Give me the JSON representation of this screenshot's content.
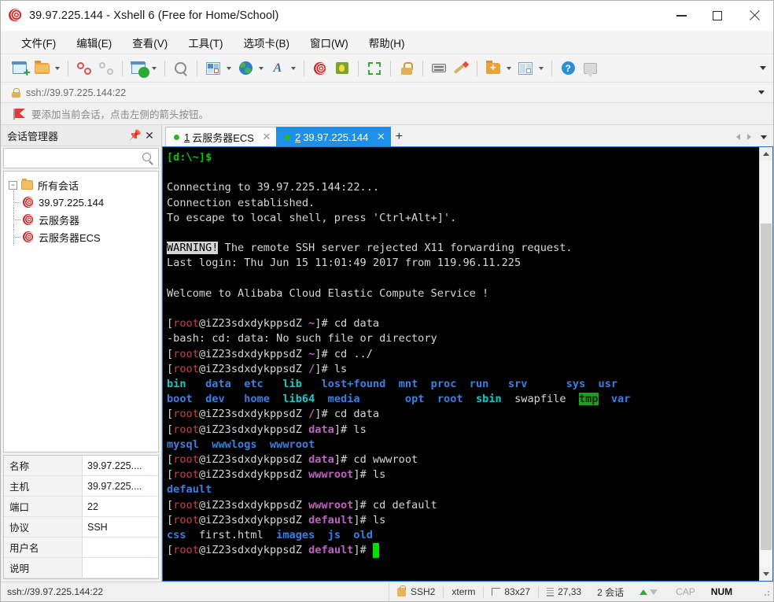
{
  "window": {
    "title": "39.97.225.144 - Xshell 6 (Free for Home/School)",
    "app_icon": "snail-icon",
    "minimize_label": "─",
    "maximize_label": "□",
    "close_label": "✕"
  },
  "menubar": {
    "items": [
      {
        "label": "文件(F)",
        "name": "menu-file"
      },
      {
        "label": "编辑(E)",
        "name": "menu-edit"
      },
      {
        "label": "查看(V)",
        "name": "menu-view"
      },
      {
        "label": "工具(T)",
        "name": "menu-tools"
      },
      {
        "label": "选项卡(B)",
        "name": "menu-tabs"
      },
      {
        "label": "窗口(W)",
        "name": "menu-window"
      },
      {
        "label": "帮助(H)",
        "name": "menu-help"
      }
    ]
  },
  "toolbar": {
    "icons": [
      "new-session-icon",
      "open-folder-icon",
      "disconnect-icon",
      "link-icon",
      "session-properties-icon",
      "find-icon",
      "layout-icon",
      "globe-icon",
      "font-icon",
      "snail-icon",
      "quick-command-icon",
      "fullscreen-icon",
      "lock-icon",
      "keyboard-icon",
      "highlight-icon",
      "transfer-icon",
      "split-view-icon",
      "help-icon",
      "chat-icon"
    ],
    "overflow_label": "▼"
  },
  "address": {
    "icon": "lock-icon",
    "value": "ssh://39.97.225.144:22",
    "dropdown_label": "▼"
  },
  "notice": {
    "icon": "red-flag-icon",
    "text": "要添加当前会话，点击左侧的箭头按钮。"
  },
  "session_manager": {
    "title": "会话管理器",
    "pin_label": "中",
    "close_label": "✕",
    "search_value": "",
    "search_placeholder": "",
    "tree": {
      "root_label": "所有会话",
      "toggle_label": "−",
      "children": [
        {
          "label": "39.97.225.144",
          "icon": "snail-icon"
        },
        {
          "label": "云服务器",
          "icon": "snail-icon"
        },
        {
          "label": "云服务器ECS",
          "icon": "snail-icon"
        }
      ]
    },
    "properties": [
      {
        "key": "名称",
        "value": "39.97.225...."
      },
      {
        "key": "主机",
        "value": "39.97.225...."
      },
      {
        "key": "端口",
        "value": "22"
      },
      {
        "key": "协议",
        "value": "SSH"
      },
      {
        "key": "用户名",
        "value": ""
      },
      {
        "key": "说明",
        "value": ""
      }
    ]
  },
  "tabs": {
    "items": [
      {
        "number": "1",
        "label": "云服务器ECS",
        "active": false,
        "status": "connected",
        "close_label": "✕"
      },
      {
        "number": "2",
        "label": "39.97.225.144",
        "active": true,
        "status": "connected",
        "close_label": "✕"
      }
    ],
    "add_label": "+",
    "nav_left": "◀",
    "nav_right": "▶",
    "nav_menu": "▼"
  },
  "terminal": {
    "colors": {
      "background": "#000000",
      "foreground": "#cfcfcf",
      "green": "#00cc00",
      "blue": "#3b7fe0",
      "cyan": "#19c8c8",
      "magenta": "#c060c0",
      "cursor": "#00e000",
      "tmp_highlight_bg": "#1ea01e"
    },
    "lines": [
      [
        {
          "t": "[d:\\~]$",
          "c": "c-green"
        }
      ],
      [],
      [
        {
          "t": "Connecting to 39.97.225.144:22...",
          "c": "c-white"
        }
      ],
      [
        {
          "t": "Connection established.",
          "c": "c-white"
        }
      ],
      [
        {
          "t": "To escape to local shell, press 'Ctrl+Alt+]'.",
          "c": "c-white"
        }
      ],
      [],
      [
        {
          "t": "WARNING!",
          "c": "inv"
        },
        {
          "t": " The remote SSH server rejected X11 forwarding request.",
          "c": "c-white"
        }
      ],
      [
        {
          "t": "Last login: Thu Jun 15 11:01:49 2017 from 119.96.11.225",
          "c": "c-white"
        }
      ],
      [],
      [
        {
          "t": "Welcome to Alibaba Cloud Elastic Compute Service !",
          "c": "c-white"
        }
      ],
      [],
      [
        {
          "t": "[",
          "c": "c-white"
        },
        {
          "t": "root",
          "c": "c-red"
        },
        {
          "t": "@iZ23sdxdykppsdZ ",
          "c": "c-white"
        },
        {
          "t": "~",
          "c": "c-magenta"
        },
        {
          "t": "]# cd data",
          "c": "c-white"
        }
      ],
      [
        {
          "t": "-bash: cd: data: No such file or directory",
          "c": "c-white"
        }
      ],
      [
        {
          "t": "[",
          "c": "c-white"
        },
        {
          "t": "root",
          "c": "c-red"
        },
        {
          "t": "@iZ23sdxdykppsdZ ",
          "c": "c-white"
        },
        {
          "t": "~",
          "c": "c-magenta"
        },
        {
          "t": "]# cd ../",
          "c": "c-white"
        }
      ],
      [
        {
          "t": "[",
          "c": "c-white"
        },
        {
          "t": "root",
          "c": "c-red"
        },
        {
          "t": "@iZ23sdxdykppsdZ ",
          "c": "c-white"
        },
        {
          "t": "/",
          "c": "c-magenta"
        },
        {
          "t": "]# ls",
          "c": "c-white"
        }
      ],
      [
        {
          "t": "bin",
          "c": "c-cyan"
        },
        {
          "t": "   ",
          "c": "c-white"
        },
        {
          "t": "data",
          "c": "c-blue"
        },
        {
          "t": "  ",
          "c": "c-white"
        },
        {
          "t": "etc",
          "c": "c-blue"
        },
        {
          "t": "   ",
          "c": "c-white"
        },
        {
          "t": "lib",
          "c": "c-cyan"
        },
        {
          "t": "   ",
          "c": "c-white"
        },
        {
          "t": "lost+found",
          "c": "c-blue"
        },
        {
          "t": "  ",
          "c": "c-white"
        },
        {
          "t": "mnt",
          "c": "c-blue"
        },
        {
          "t": "  ",
          "c": "c-white"
        },
        {
          "t": "proc",
          "c": "c-blue"
        },
        {
          "t": "  ",
          "c": "c-white"
        },
        {
          "t": "run",
          "c": "c-blue"
        },
        {
          "t": "   ",
          "c": "c-white"
        },
        {
          "t": "srv",
          "c": "c-blue"
        },
        {
          "t": "      ",
          "c": "c-white"
        },
        {
          "t": "sys",
          "c": "c-blue"
        },
        {
          "t": "  ",
          "c": "c-white"
        },
        {
          "t": "usr",
          "c": "c-blue"
        }
      ],
      [
        {
          "t": "boot",
          "c": "c-blue"
        },
        {
          "t": "  ",
          "c": "c-white"
        },
        {
          "t": "dev",
          "c": "c-blue"
        },
        {
          "t": "   ",
          "c": "c-white"
        },
        {
          "t": "home",
          "c": "c-blue"
        },
        {
          "t": "  ",
          "c": "c-white"
        },
        {
          "t": "lib64",
          "c": "c-cyan"
        },
        {
          "t": "  ",
          "c": "c-white"
        },
        {
          "t": "media",
          "c": "c-blue"
        },
        {
          "t": "       ",
          "c": "c-white"
        },
        {
          "t": "opt",
          "c": "c-blue"
        },
        {
          "t": "  ",
          "c": "c-white"
        },
        {
          "t": "root",
          "c": "c-blue"
        },
        {
          "t": "  ",
          "c": "c-white"
        },
        {
          "t": "sbin",
          "c": "c-cyan"
        },
        {
          "t": "  ",
          "c": "c-white"
        },
        {
          "t": "swapfile",
          "c": "c-white"
        },
        {
          "t": "  ",
          "c": "c-white"
        },
        {
          "t": "tmp",
          "c": "tmphl"
        },
        {
          "t": "  ",
          "c": "c-white"
        },
        {
          "t": "var",
          "c": "c-blue"
        }
      ],
      [
        {
          "t": "[",
          "c": "c-white"
        },
        {
          "t": "root",
          "c": "c-red"
        },
        {
          "t": "@iZ23sdxdykppsdZ ",
          "c": "c-white"
        },
        {
          "t": "/",
          "c": "c-magenta"
        },
        {
          "t": "]# cd data",
          "c": "c-white"
        }
      ],
      [
        {
          "t": "[",
          "c": "c-white"
        },
        {
          "t": "root",
          "c": "c-red"
        },
        {
          "t": "@iZ23sdxdykppsdZ ",
          "c": "c-white"
        },
        {
          "t": "data",
          "c": "c-magenta"
        },
        {
          "t": "]# ls",
          "c": "c-white"
        }
      ],
      [
        {
          "t": "mysql",
          "c": "c-blue"
        },
        {
          "t": "  ",
          "c": "c-white"
        },
        {
          "t": "wwwlogs",
          "c": "c-blue"
        },
        {
          "t": "  ",
          "c": "c-white"
        },
        {
          "t": "wwwroot",
          "c": "c-blue"
        }
      ],
      [
        {
          "t": "[",
          "c": "c-white"
        },
        {
          "t": "root",
          "c": "c-red"
        },
        {
          "t": "@iZ23sdxdykppsdZ ",
          "c": "c-white"
        },
        {
          "t": "data",
          "c": "c-magenta"
        },
        {
          "t": "]# cd wwwroot",
          "c": "c-white"
        }
      ],
      [
        {
          "t": "[",
          "c": "c-white"
        },
        {
          "t": "root",
          "c": "c-red"
        },
        {
          "t": "@iZ23sdxdykppsdZ ",
          "c": "c-white"
        },
        {
          "t": "wwwroot",
          "c": "c-magenta"
        },
        {
          "t": "]# ls",
          "c": "c-white"
        }
      ],
      [
        {
          "t": "default",
          "c": "c-blue"
        }
      ],
      [
        {
          "t": "[",
          "c": "c-white"
        },
        {
          "t": "root",
          "c": "c-red"
        },
        {
          "t": "@iZ23sdxdykppsdZ ",
          "c": "c-white"
        },
        {
          "t": "wwwroot",
          "c": "c-magenta"
        },
        {
          "t": "]# cd default",
          "c": "c-white"
        }
      ],
      [
        {
          "t": "[",
          "c": "c-white"
        },
        {
          "t": "root",
          "c": "c-red"
        },
        {
          "t": "@iZ23sdxdykppsdZ ",
          "c": "c-white"
        },
        {
          "t": "default",
          "c": "c-magenta"
        },
        {
          "t": "]# ls",
          "c": "c-white"
        }
      ],
      [
        {
          "t": "css",
          "c": "c-blue"
        },
        {
          "t": "  ",
          "c": "c-white"
        },
        {
          "t": "first.html",
          "c": "c-white"
        },
        {
          "t": "  ",
          "c": "c-white"
        },
        {
          "t": "images",
          "c": "c-blue"
        },
        {
          "t": "  ",
          "c": "c-white"
        },
        {
          "t": "js",
          "c": "c-blue"
        },
        {
          "t": "  ",
          "c": "c-white"
        },
        {
          "t": "old",
          "c": "c-blue"
        }
      ],
      [
        {
          "t": "[",
          "c": "c-white"
        },
        {
          "t": "root",
          "c": "c-red"
        },
        {
          "t": "@iZ23sdxdykppsdZ ",
          "c": "c-white"
        },
        {
          "t": "default",
          "c": "c-magenta"
        },
        {
          "t": "]# ",
          "c": "c-white"
        },
        {
          "t": " ",
          "c": "cursor"
        }
      ]
    ]
  },
  "statusbar": {
    "url": "ssh://39.97.225.144:22",
    "protocol": "SSH2",
    "term_type": "xterm",
    "dimensions": "83x27",
    "cursor_pos": "27,33",
    "sessions": "2 会话",
    "cap": "CAP",
    "num": "NUM"
  }
}
